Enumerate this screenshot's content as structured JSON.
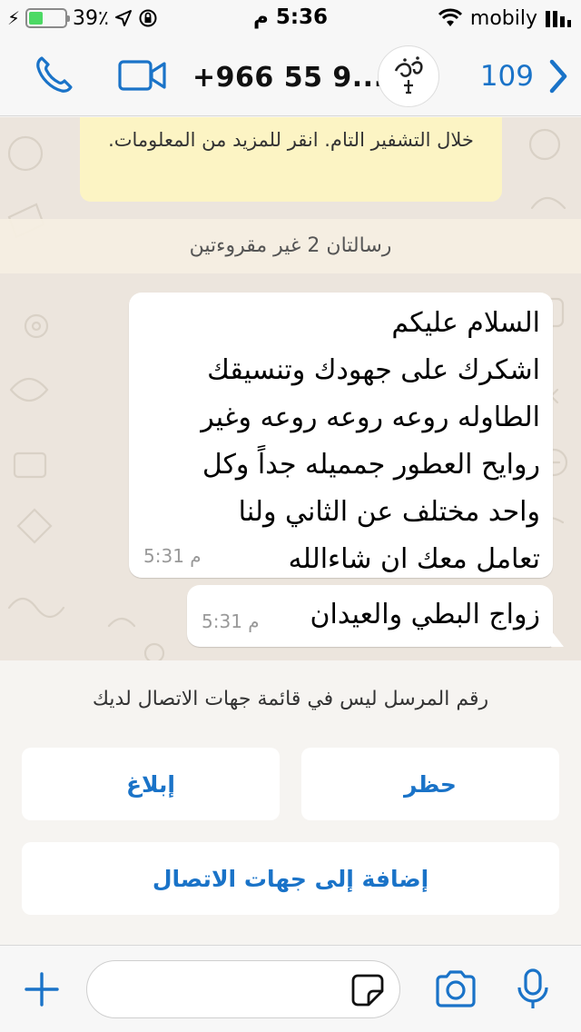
{
  "status_bar": {
    "battery_text": "39٪",
    "battery_level": 0.39,
    "time": "5:36 م",
    "carrier": "mobily"
  },
  "header": {
    "back_count": "109",
    "contact_name": "+966 55 9...",
    "avatar_icon": "contact-avatar-logo",
    "call_icon": "phone-icon",
    "video_icon": "video-camera-icon"
  },
  "chat": {
    "encryption_notice": "خلال التشفير التام. انقر للمزيد من المعلومات.",
    "unread_banner": "رسالتان 2 غير مقروءتين",
    "messages": [
      {
        "text": "السلام عليكم\nاشكرك على جهودك وتنسيقك\nالطاوله روعه روعه روعه وغير\nروايح العطور جمميله جداً وكل\nواحد مختلف عن الثاني ولنا\nتعامل معك ان شاءالله",
        "time": "م 5:31"
      },
      {
        "text": "زواج البطي والعيدان",
        "time": "م 5:31"
      }
    ]
  },
  "unknown_panel": {
    "note": "رقم المرسل ليس في قائمة جهات الاتصال لديك",
    "block_label": "حظر",
    "report_label": "إبلاغ",
    "add_contact_label": "إضافة إلى جهات الاتصال"
  },
  "composer": {
    "placeholder": "",
    "attach_icon": "plus-icon",
    "sticker_icon": "sticker-icon",
    "camera_icon": "camera-icon",
    "mic_icon": "microphone-icon"
  },
  "colors": {
    "accent": "#1a73c8",
    "chat_bg": "#ece5dd",
    "notice_bg": "#fcf4c4",
    "battery_fill": "#4cd964"
  }
}
